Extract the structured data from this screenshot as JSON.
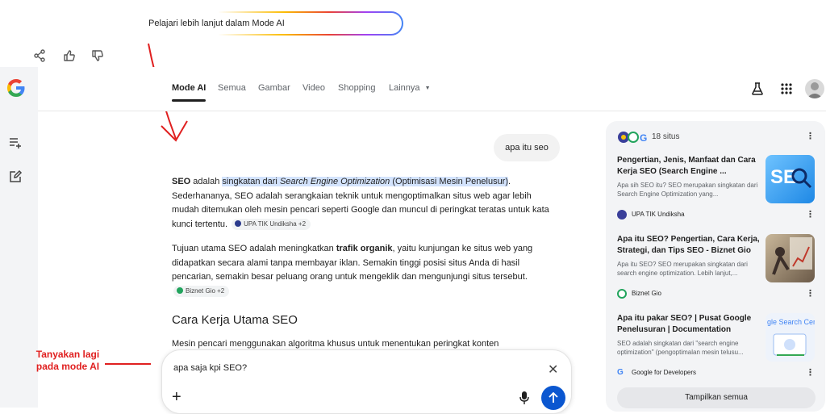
{
  "banner": {
    "learn_more": "Pelajari lebih lanjut dalam Mode AI"
  },
  "header": {
    "tabs": [
      {
        "label": "Mode AI",
        "active": true
      },
      {
        "label": "Semua"
      },
      {
        "label": "Gambar"
      },
      {
        "label": "Video"
      },
      {
        "label": "Shopping"
      },
      {
        "label": "Lainnya"
      }
    ]
  },
  "chat": {
    "user_query": "apa itu seo",
    "answer": {
      "p1": {
        "lead": "SEO",
        "t1": " adalah ",
        "hl1": "singkatan dari ",
        "hl_italic": "Search Engine Optimization",
        "hl2": " (Optimisasi Mesin Penelusur)",
        "t2": ". Sederhananya, SEO adalah serangkaian teknik untuk mengoptimalkan situs web agar lebih mudah ditemukan oleh mesin pencari seperti Google dan muncul di peringkat teratas untuk kata kunci tertentu.",
        "chip": "UPA TIK Undiksha +2"
      },
      "p2": {
        "t1": "Tujuan utama SEO adalah meningkatkan ",
        "bold": "trafik organik",
        "t2": ", yaitu kunjungan ke situs web yang didapatkan secara alami tanpa membayar iklan. Semakin tinggi posisi situs Anda di hasil pencarian, semakin besar peluang orang untuk mengeklik dan mengunjungi situs tersebut.",
        "chip": "Biznet Gio +2"
      },
      "heading": "Cara Kerja Utama SEO",
      "p3": "Mesin pencari menggunakan algoritma khusus untuk menentukan peringkat konten"
    }
  },
  "input": {
    "value": "apa saja kpi SEO?"
  },
  "annotation": {
    "line1": "Tanyakan lagi",
    "line2": "pada mode AI"
  },
  "sources": {
    "count": "18 situs",
    "cards": [
      {
        "title": "Pengertian, Jenis, Manfaat dan Cara Kerja SEO (Search Engine ...",
        "snippet": "Apa sih SEO itu? SEO merupakan singkatan dari Search Engine Optimization yang...",
        "source": "UPA TIK Undiksha",
        "thumb_text": "SE"
      },
      {
        "title": "Apa itu SEO? Pengertian, Cara Kerja, Strategi, dan Tips SEO - Biznet Gio",
        "snippet": "Apa itu SEO? SEO merupakan singkatan dari search engine optimization. Lebih lanjut,...",
        "source": "Biznet Gio"
      },
      {
        "title": "Apa itu pakar SEO? | Pusat Google Penelusuran | Documentation",
        "snippet": "SEO adalah singkatan dari \"search engine optimization\" (pengoptimalan mesin telusu...",
        "source": "Google for Developers",
        "thumb_text": "gle Search Cen"
      }
    ],
    "show_all": "Tampilkan semua"
  },
  "colors": {
    "accent": "#0b57d0",
    "annotation": "#e02020",
    "highlight": "#d3e3fd"
  }
}
